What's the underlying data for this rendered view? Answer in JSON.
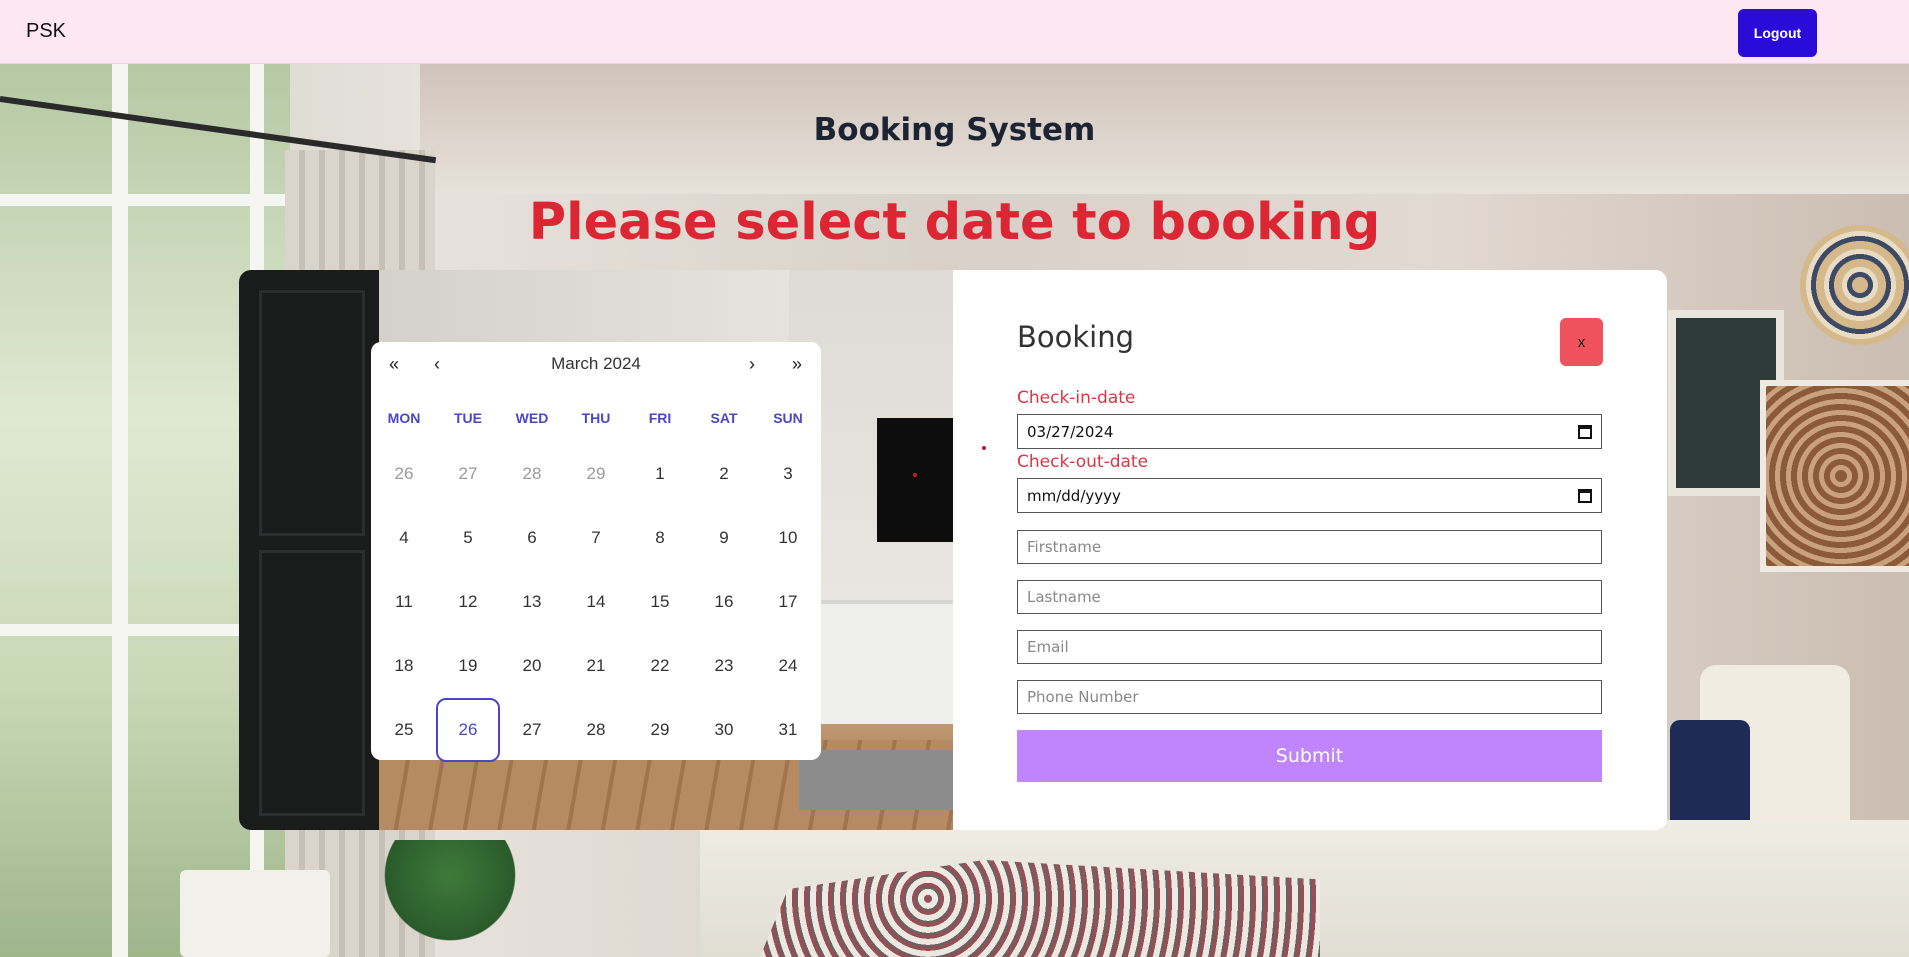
{
  "navbar": {
    "brand": "PSK",
    "logout_label": "Logout"
  },
  "page": {
    "title": "Booking System",
    "subtitle": "Please select date to booking"
  },
  "form": {
    "title": "Booking",
    "close_label": "x",
    "checkin_label": "Check-in-date",
    "checkin_value": "03/27/2024",
    "checkout_label": "Check-out-date",
    "checkout_placeholder": "mm/dd/yyyy",
    "firstname_placeholder": "Firstname",
    "lastname_placeholder": "Lastname",
    "email_placeholder": "Email",
    "phone_placeholder": "Phone Number",
    "submit_label": "Submit"
  },
  "calendar": {
    "month_label": "March 2024",
    "nav": {
      "prev_year": "«",
      "prev_month": "‹",
      "next_month": "›",
      "next_year": "»"
    },
    "weekdays": [
      "MON",
      "TUE",
      "WED",
      "THU",
      "FRI",
      "SAT",
      "SUN"
    ],
    "weeks": [
      [
        "26",
        "27",
        "28",
        "29",
        "1",
        "2",
        "3"
      ],
      [
        "4",
        "5",
        "6",
        "7",
        "8",
        "9",
        "10"
      ],
      [
        "11",
        "12",
        "13",
        "14",
        "15",
        "16",
        "17"
      ],
      [
        "18",
        "19",
        "20",
        "21",
        "22",
        "23",
        "24"
      ],
      [
        "25",
        "26",
        "27",
        "28",
        "29",
        "30",
        "31"
      ]
    ],
    "today": "26"
  },
  "colors": {
    "navbar_bg": "#fce7f3",
    "logout_bg": "#2a0bd8",
    "subtitle": "#dc2633",
    "label": "#dc3545",
    "submit_bg": "#c084fc",
    "close_bg": "#f0525d",
    "calendar_accent": "#4b46c8"
  }
}
